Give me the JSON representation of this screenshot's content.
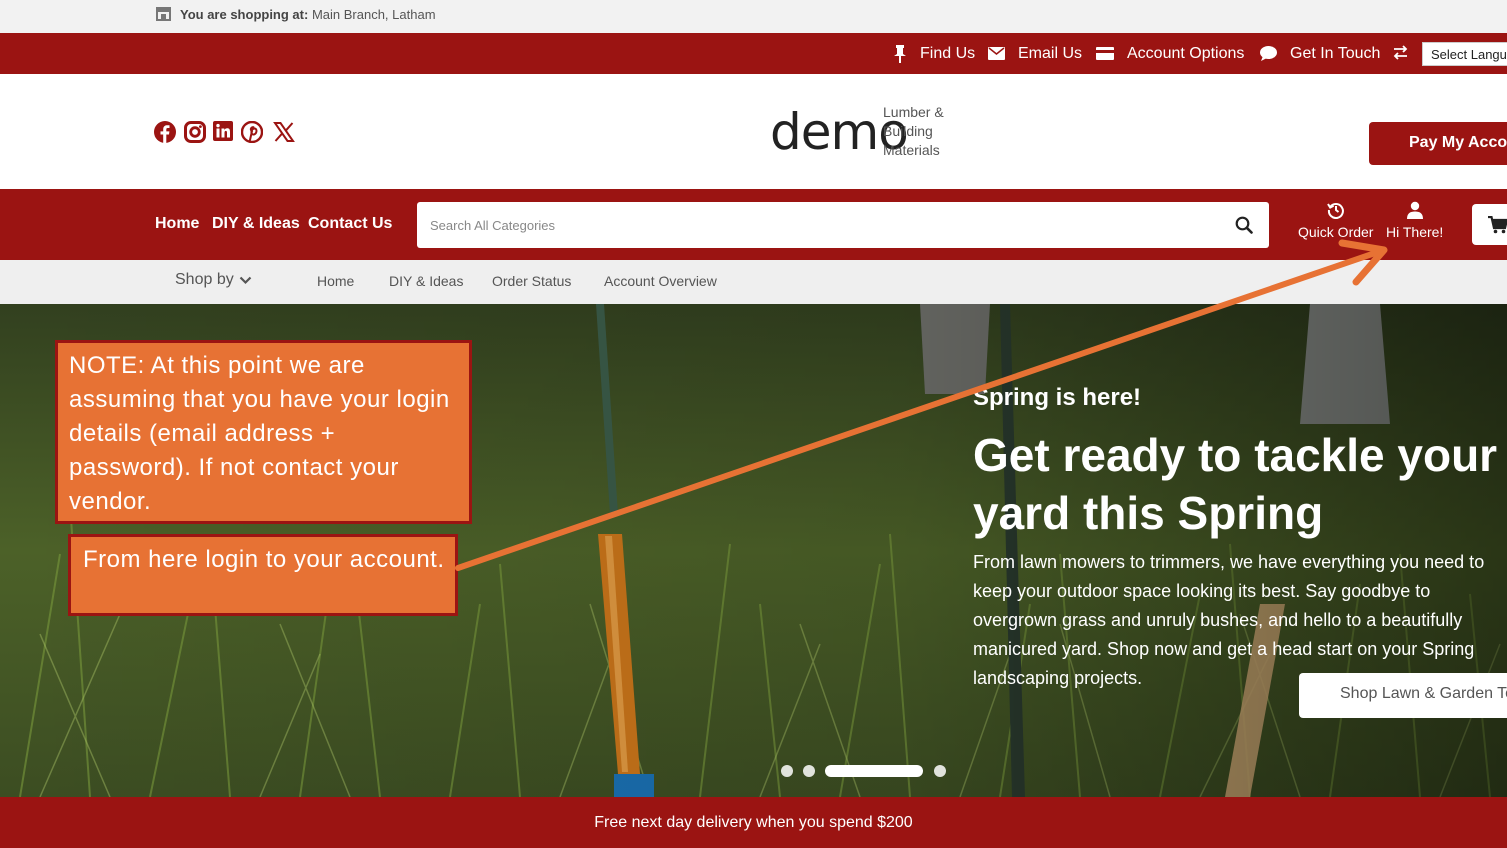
{
  "store_bar": {
    "prefix": "You are shopping at:",
    "location": "Main Branch, Latham"
  },
  "utility_nav": [
    {
      "label": "Find Us",
      "icon": "pin-icon"
    },
    {
      "label": "Email Us",
      "icon": "envelope-icon"
    },
    {
      "label": "Account Options",
      "icon": "credit-card-icon"
    },
    {
      "label": "Get In Touch",
      "icon": "chat-bubble-icon"
    }
  ],
  "language_select": {
    "label": "Select Language",
    "icon": "google-icon"
  },
  "social": [
    "facebook-icon",
    "instagram-icon",
    "linkedin-icon",
    "pinterest-icon",
    "x-icon"
  ],
  "logo": {
    "word": "demo",
    "tagline": [
      "Lumber &",
      "Building",
      "Materials"
    ]
  },
  "pay_button": "Pay My Account",
  "main_nav": [
    "Home",
    "DIY & Ideas",
    "Contact Us"
  ],
  "search": {
    "placeholder": "Search All Categories"
  },
  "nav_actions": {
    "quick_order": "Quick Order",
    "account": "Hi There!"
  },
  "sub_nav": {
    "shop_by": "Shop by",
    "links": [
      "Home",
      "DIY & Ideas",
      "Order Status",
      "Account Overview"
    ]
  },
  "hero": {
    "eyebrow": "Spring is here!",
    "title": "Get ready to tackle your yard this Spring",
    "body": "From lawn mowers to trimmers, we have everything you need to keep your outdoor space looking its best. Say goodbye to overgrown grass and unruly bushes, and hello to a beautifully manicured yard. Shop now and get a head start on your Spring landscaping projects.",
    "cta": "Shop Lawn & Garden Tools",
    "slides": 4,
    "active_slide": 3
  },
  "annotations": {
    "note1": "NOTE: At this point we are assuming that you have your login details (email address + password). If not contact your vendor.",
    "note2": "From here login to your account."
  },
  "promo": "Free next day delivery when you spend $200",
  "colors": {
    "brand_red": "#9b1412",
    "annotation_orange": "#e77234",
    "sub_nav_bg": "#efefef"
  }
}
